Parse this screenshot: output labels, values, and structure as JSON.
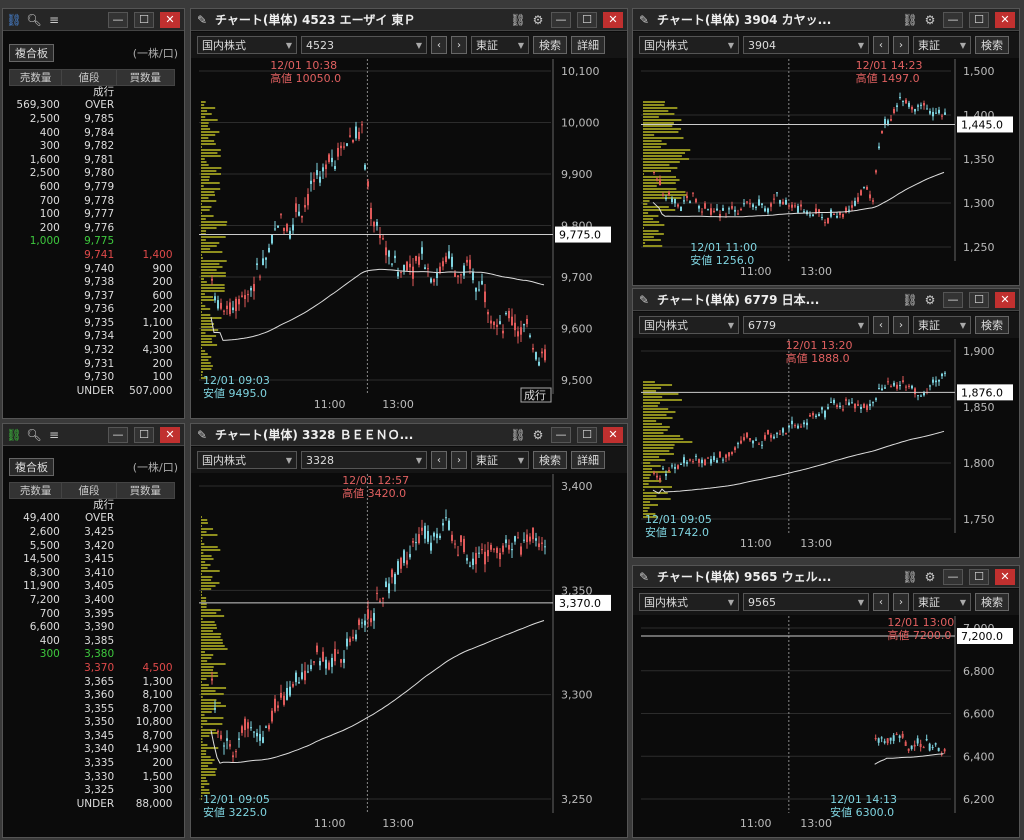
{
  "boards": [
    {
      "icon": "link-icon",
      "title_ic": "2",
      "header_label": "複合板",
      "unit": "(一株/口)",
      "cols": [
        "売数量",
        "値段",
        "買数量"
      ],
      "rows": [
        [
          "",
          "成行",
          ""
        ],
        [
          "569,300",
          "OVER",
          ""
        ],
        [
          "2,500",
          "9,785",
          ""
        ],
        [
          "400",
          "9,784",
          ""
        ],
        [
          "300",
          "9,782",
          ""
        ],
        [
          "1,600",
          "9,781",
          ""
        ],
        [
          "2,500",
          "9,780",
          ""
        ],
        [
          "600",
          "9,779",
          ""
        ],
        [
          "700",
          "9,778",
          ""
        ],
        [
          "100",
          "9,777",
          ""
        ],
        [
          "200",
          "9,776",
          ""
        ],
        [
          "1,000",
          "9,775",
          ""
        ],
        [
          "",
          "9,741",
          "1,400"
        ],
        [
          "",
          "9,740",
          "900"
        ],
        [
          "",
          "9,738",
          "200"
        ],
        [
          "",
          "9,737",
          "600"
        ],
        [
          "",
          "9,736",
          "200"
        ],
        [
          "",
          "9,735",
          "1,100"
        ],
        [
          "",
          "9,734",
          "200"
        ],
        [
          "",
          "9,732",
          "4,300"
        ],
        [
          "",
          "9,731",
          "200"
        ],
        [
          "",
          "9,730",
          "100"
        ],
        [
          "",
          "UNDER",
          "507,000"
        ]
      ],
      "hl_green": 11,
      "hl_red": 12
    },
    {
      "icon": "link-icon",
      "title_ic": "3",
      "header_label": "複合板",
      "unit": "(一株/口)",
      "cols": [
        "売数量",
        "値段",
        "買数量"
      ],
      "rows": [
        [
          "",
          "成行",
          ""
        ],
        [
          "49,400",
          "OVER",
          ""
        ],
        [
          "2,600",
          "3,425",
          ""
        ],
        [
          "5,500",
          "3,420",
          ""
        ],
        [
          "14,500",
          "3,415",
          ""
        ],
        [
          "8,300",
          "3,410",
          ""
        ],
        [
          "11,900",
          "3,405",
          ""
        ],
        [
          "7,200",
          "3,400",
          ""
        ],
        [
          "700",
          "3,395",
          ""
        ],
        [
          "6,600",
          "3,390",
          ""
        ],
        [
          "400",
          "3,385",
          ""
        ],
        [
          "300",
          "3,380",
          ""
        ],
        [
          "",
          "3,370",
          "4,500"
        ],
        [
          "",
          "3,365",
          "1,300"
        ],
        [
          "",
          "3,360",
          "8,100"
        ],
        [
          "",
          "3,355",
          "8,700"
        ],
        [
          "",
          "3,350",
          "10,800"
        ],
        [
          "",
          "3,345",
          "8,700"
        ],
        [
          "",
          "3,340",
          "14,900"
        ],
        [
          "",
          "3,335",
          "200"
        ],
        [
          "",
          "3,330",
          "1,500"
        ],
        [
          "",
          "3,325",
          "300"
        ],
        [
          "",
          "UNDER",
          "88,000"
        ]
      ],
      "hl_green": 11,
      "hl_red": 12
    }
  ],
  "charts": [
    {
      "title": "チャート(単体) 4523 エーザイ 東Ｐ",
      "market": "国内株式",
      "code": "4523",
      "exch": "東証",
      "search": "検索",
      "detail": "詳細",
      "high_time": "12/01 10:38",
      "high_label": "高値 10050.0",
      "low_time": "12/01 09:03",
      "low_label": "安値 9495.0",
      "price_label": "9,775.0",
      "badge": "成行",
      "y_ticks": [
        "10,100",
        "10,000",
        "9,900",
        "9,800",
        "9,700",
        "9,600",
        "9,500"
      ],
      "x_ticks": [
        "11:00",
        "13:00"
      ]
    },
    {
      "title": "チャート(単体) 3328 ＢＥＥＮＯ...",
      "market": "国内株式",
      "code": "3328",
      "exch": "東証",
      "search": "検索",
      "detail": "詳細",
      "high_time": "12/01 12:57",
      "high_label": "高値 3420.0",
      "low_time": "12/01 09:05",
      "low_label": "安値 3225.0",
      "price_label": "3,370.0",
      "y_ticks": [
        "3,400",
        "3,350",
        "3,300",
        "3,250"
      ],
      "x_ticks": [
        "11:00",
        "13:00"
      ]
    },
    {
      "title": "チャート(単体) 3904 カヤッ...",
      "market": "国内株式",
      "code": "3904",
      "exch": "東証",
      "search": "検索",
      "high_time": "12/01 14:23",
      "high_label": "高値 1497.0",
      "low_time": "12/01 11:00",
      "low_label": "安値 1256.0",
      "price_label": "1,445.0",
      "y_ticks": [
        "1,500",
        "1,400",
        "1,350",
        "1,300",
        "1,250"
      ],
      "x_ticks": [
        "11:00",
        "13:00"
      ]
    },
    {
      "title": "チャート(単体) 6779 日本...",
      "market": "国内株式",
      "code": "6779",
      "exch": "東証",
      "search": "検索",
      "high_time": "12/01 13:20",
      "high_label": "高値 1888.0",
      "low_time": "12/01 09:05",
      "low_label": "安値 1742.0",
      "price_label": "1,876.0",
      "y_ticks": [
        "1,900",
        "1,850",
        "1,800",
        "1,750"
      ],
      "x_ticks": [
        "11:00",
        "13:00"
      ]
    },
    {
      "title": "チャート(単体) 9565 ウェル...",
      "market": "国内株式",
      "code": "9565",
      "exch": "東証",
      "search": "検索",
      "high_time": "12/01 13:00",
      "high_label": "高値 7200.0",
      "low_time": "12/01 14:13",
      "low_label": "安値 6300.0",
      "price_label": "7,200.0",
      "y_ticks": [
        "7,000",
        "6,800",
        "6,600",
        "6,400",
        "6,200"
      ],
      "x_ticks": [
        "11:00",
        "13:00"
      ]
    }
  ]
}
